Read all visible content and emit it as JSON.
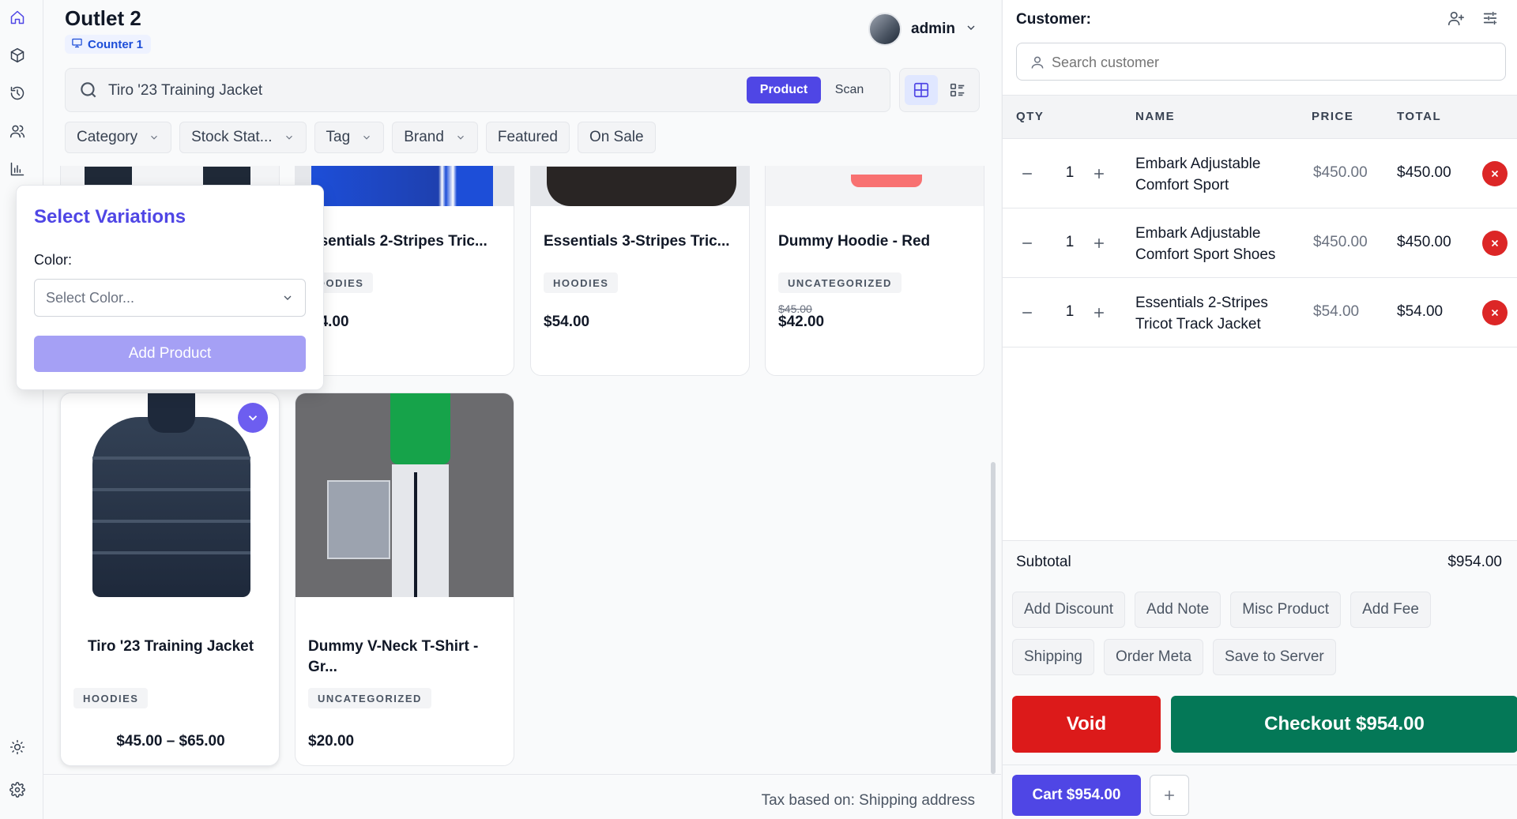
{
  "header": {
    "store_name": "Outlet 2",
    "counter": "Counter 1",
    "user": "admin"
  },
  "search": {
    "value": "Tiro '23 Training Jacket",
    "mode_product": "Product",
    "mode_scan": "Scan"
  },
  "filters": [
    "Category",
    "Stock Stat...",
    "Tag",
    "Brand",
    "Featured",
    "On Sale"
  ],
  "products": [
    {
      "title": "ssentials 2-Stripes Tric...",
      "category": "HOODIES",
      "price": "54.00"
    },
    {
      "title": "Essentials 3-Stripes Tric...",
      "category": "HOODIES",
      "price": "$54.00"
    },
    {
      "title": "Dummy Hoodie - Red",
      "category": "UNCATEGORIZED",
      "old_price": "$45.00",
      "price": "$42.00"
    },
    {
      "title": "Tiro '23 Training Jacket",
      "category": "HOODIES",
      "price": "$45.00 – $65.00"
    },
    {
      "title": "Dummy V-Neck T-Shirt - Gr...",
      "category": "UNCATEGORIZED",
      "price": "$20.00"
    }
  ],
  "popup": {
    "title": "Select Variations",
    "color_label": "Color:",
    "color_placeholder": "Select Color...",
    "add_button": "Add Product"
  },
  "footer": {
    "tax_note": "Tax based on: Shipping address"
  },
  "cart": {
    "customer_label": "Customer:",
    "customer_placeholder": "Search customer",
    "columns": {
      "qty": "QTY",
      "name": "NAME",
      "price": "PRICE",
      "total": "TOTAL"
    },
    "items": [
      {
        "qty": "1",
        "name": "Embark Adjustable Comfort Sport",
        "price": "$450.00",
        "total": "$450.00"
      },
      {
        "qty": "1",
        "name": "Embark Adjustable Comfort Sport Shoes",
        "price": "$450.00",
        "total": "$450.00"
      },
      {
        "qty": "1",
        "name": "Essentials 2-Stripes Tricot Track Jacket",
        "price": "$54.00",
        "total": "$54.00"
      }
    ],
    "subtotal_label": "Subtotal",
    "subtotal_value": "$954.00",
    "actions_row1": [
      "Add Discount",
      "Add Note",
      "Misc Product",
      "Add Fee"
    ],
    "actions_row2": [
      "Shipping",
      "Order Meta",
      "Save to Server"
    ],
    "void": "Void",
    "checkout": "Checkout $954.00",
    "cart_tab": "Cart $954.00"
  },
  "colors": {
    "accent": "#4f46e5",
    "void": "#dc1a1a",
    "checkout": "#047857"
  }
}
